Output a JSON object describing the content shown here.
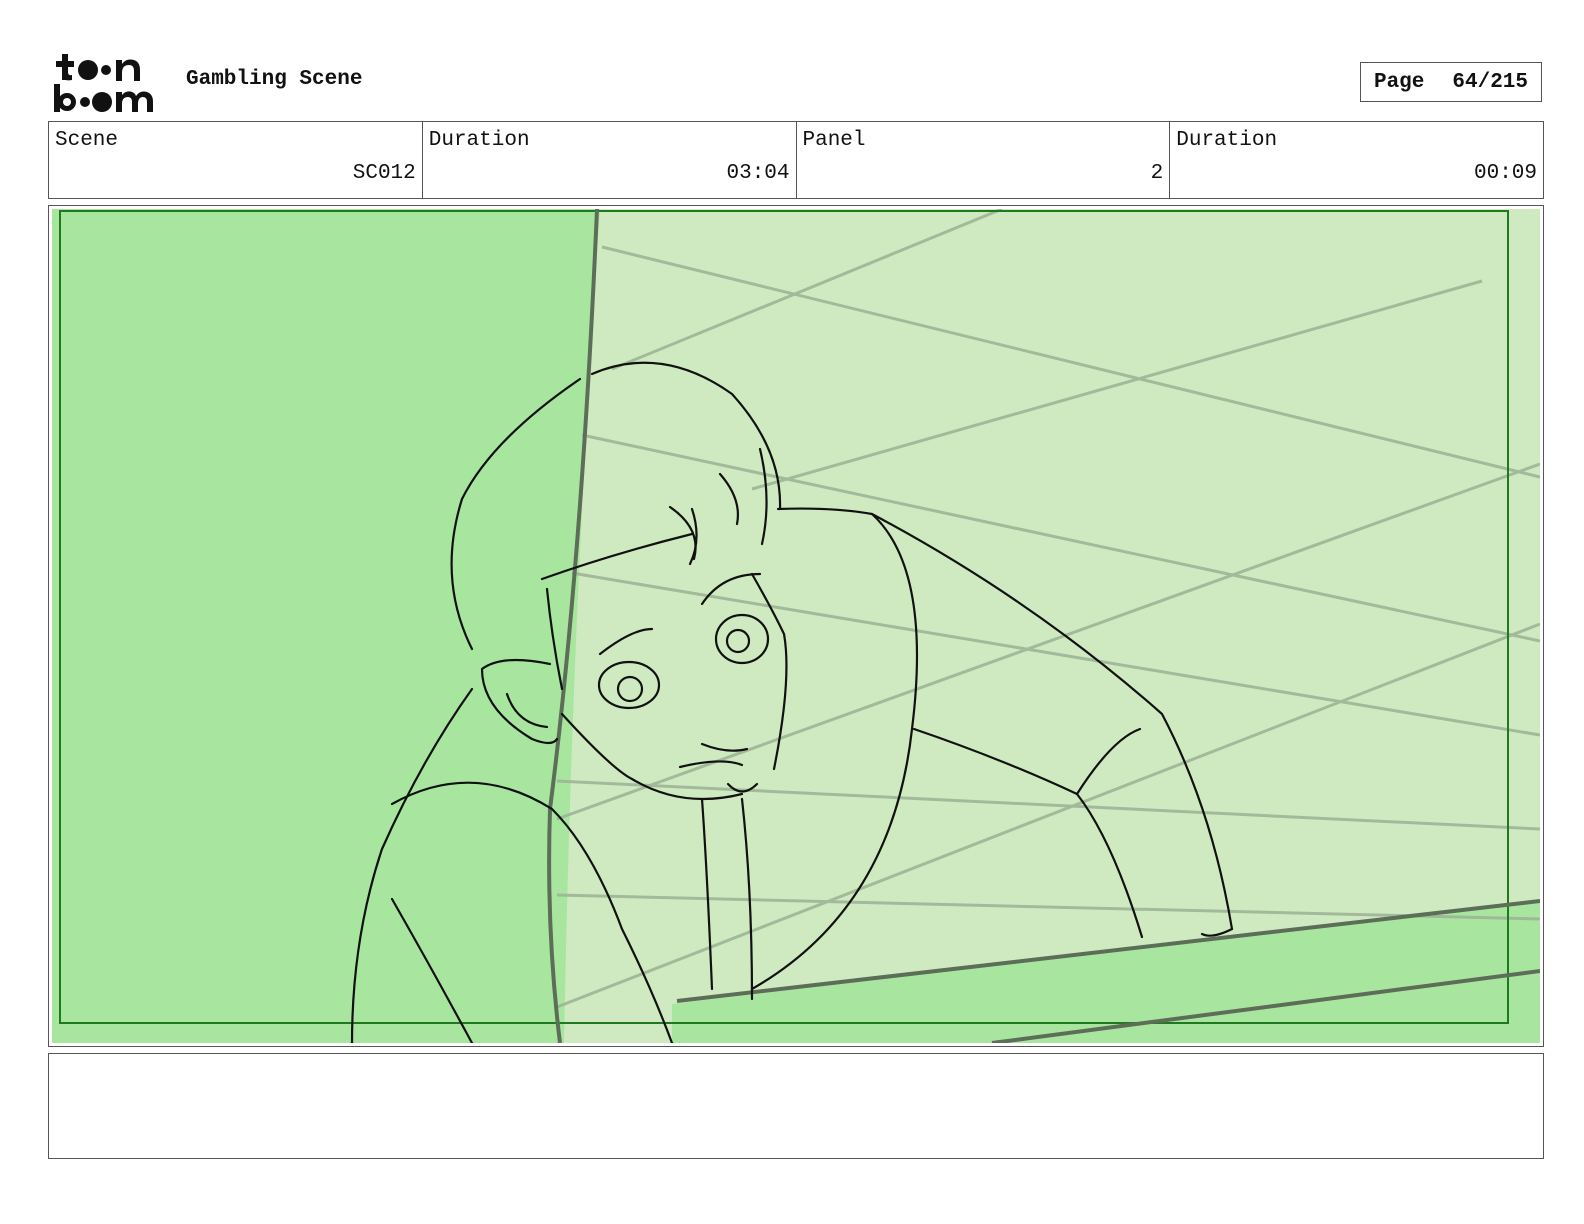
{
  "header": {
    "logo_text": "toon boom",
    "title": "Gambling Scene",
    "page_label": "Page",
    "page_value": "64/215"
  },
  "info": [
    {
      "label": "Scene",
      "value": "SC012"
    },
    {
      "label": "Duration",
      "value": "03:04"
    },
    {
      "label": "Panel",
      "value": "2"
    },
    {
      "label": "Duration",
      "value": "00:09"
    }
  ],
  "panel": {
    "colors": {
      "foreground_green": "#a8e6a0",
      "background_green": "#cfeac0",
      "frame_green": "#1f7a1f",
      "sketch_line": "#111111",
      "construction_line": "#9fb497"
    }
  },
  "notes": {
    "text": ""
  }
}
